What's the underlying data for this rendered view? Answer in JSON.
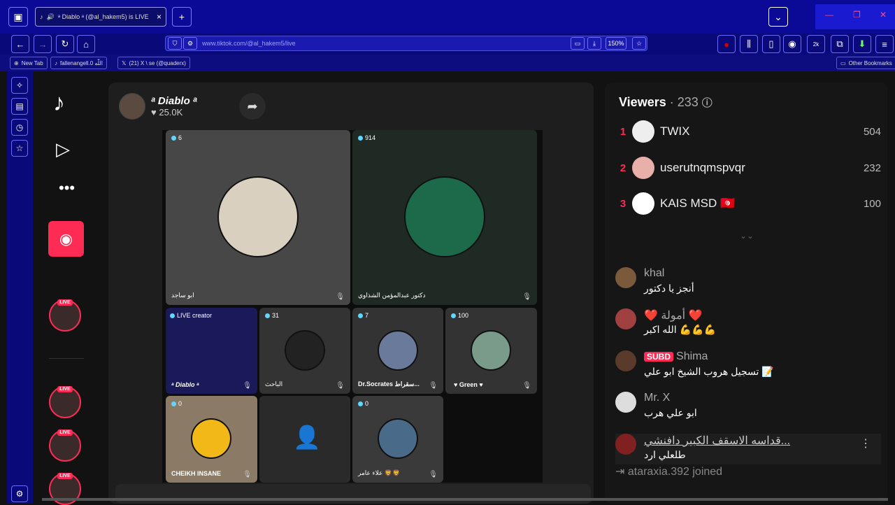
{
  "browser": {
    "tab_title": "ᵃ Diablo ᵃ (@al_hakem5) is LIVE",
    "url": "www.tiktok.com/@al_hakem5/live",
    "zoom": "150%",
    "badge_count": "2k",
    "bookmarks": [
      "New Tab",
      "fallenangell.0 اللّه",
      "(21) X \\ se (@quaderx)"
    ],
    "other_bookmarks": "Other Bookmarks"
  },
  "stage": {
    "host_name": "ᵃ Diablo ᵃ",
    "host_likes": "25.0K",
    "cells": [
      {
        "count": "6",
        "name": "ابو ساجد"
      },
      {
        "count": "914",
        "name": "دكتور عبدالمؤمن الشذاوي"
      },
      {
        "count": "LIVE creator",
        "name": "ᵃ Diablo ᵃ"
      },
      {
        "count": "31",
        "name": "الباحث"
      },
      {
        "count": "7",
        "name": "Dr.Socrates سقراط..."
      },
      {
        "count": "100",
        "name": "♥ Green ♥"
      },
      {
        "count": "0",
        "name": "CHEIKH INSANE"
      },
      {
        "count": "0",
        "name": "علاء عامر 🦁🦁"
      }
    ]
  },
  "viewers": {
    "title": "Viewers",
    "count": "· 233",
    "list": [
      {
        "rank": "1",
        "name": "TWIX",
        "score": "504"
      },
      {
        "rank": "2",
        "name": "userutnqmspvqr",
        "score": "232"
      },
      {
        "rank": "3",
        "name": "KAIS MSD 🇹🇳",
        "score": "100"
      }
    ]
  },
  "chat": [
    {
      "name": "khal",
      "text": "أنجز يا دكتور"
    },
    {
      "name": "❤️ أمولة ❤️",
      "text": "الله اكبر 💪💪💪"
    },
    {
      "badge": "SUBD",
      "name": "Shima",
      "text": "تسجيل هروب الشيخ ابو علي 📝"
    },
    {
      "name": "Mr. X",
      "text": "ابو علي هرب"
    },
    {
      "name": "قداسه الاسقف الكبير دافنشي...",
      "text": "طلعلي ارد"
    }
  ],
  "join": {
    "user": "ataraxia.392",
    "text": "joined"
  }
}
